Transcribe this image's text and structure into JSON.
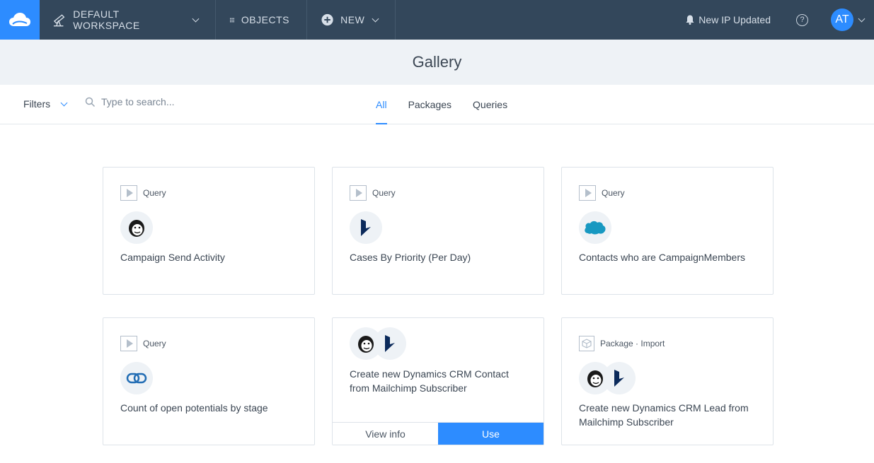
{
  "topbar": {
    "workspace_label": "DEFAULT WORKSPACE",
    "objects_label": "OBJECTS",
    "new_label": "NEW",
    "notification_label": "New IP Updated",
    "help_label": "?",
    "avatar_initials": "AT"
  },
  "page": {
    "title": "Gallery"
  },
  "filterbar": {
    "filters_label": "Filters",
    "search_placeholder": "Type to search...",
    "tabs": [
      {
        "label": "All",
        "active": true
      },
      {
        "label": "Packages",
        "active": false
      },
      {
        "label": "Queries",
        "active": false
      }
    ]
  },
  "cards": [
    {
      "type": "Query",
      "title": "Campaign Send Activity",
      "logos": [
        "mailchimp-logo"
      ]
    },
    {
      "type": "Query",
      "title": "Cases By Priority (Per Day)",
      "logos": [
        "dynamics-logo"
      ]
    },
    {
      "type": "Query",
      "title": "Contacts who are CampaignMembers",
      "logos": [
        "salesforce-logo"
      ]
    },
    {
      "type": "Query",
      "title": "Count of open potentials by stage",
      "logos": [
        "zoho-logo"
      ]
    },
    {
      "type": "",
      "title": "Create new Dynamics CRM Contact from Mailchimp Subscriber",
      "logos": [
        "mailchimp-logo",
        "dynamics-logo"
      ],
      "actions": {
        "info_label": "View info",
        "use_label": "Use"
      }
    },
    {
      "type": "Package · Import",
      "title": "Create new Dynamics CRM Lead from Mailchimp Subscriber",
      "logos": [
        "mailchimp-logo",
        "dynamics-logo"
      ]
    }
  ],
  "colors": {
    "topbar": "#33475b",
    "accent": "#2d8cff",
    "header_bg": "#eef2f6"
  }
}
